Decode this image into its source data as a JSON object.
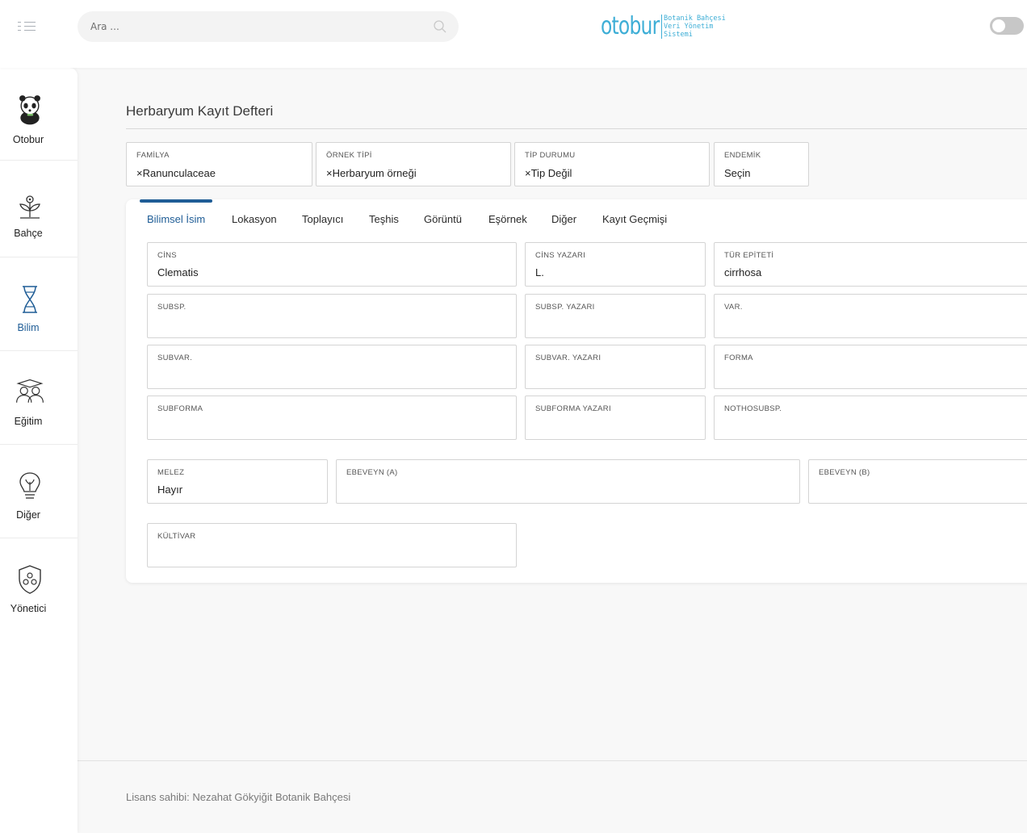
{
  "header": {
    "search_placeholder": "Ara ...",
    "logo_word": "otobur",
    "logo_sub": [
      "Botanik Bahçesi",
      "Veri Yönetim",
      "Sistemi"
    ]
  },
  "sidebar": {
    "items": [
      {
        "label": "Otobur",
        "icon": "panda-icon"
      },
      {
        "label": "Bahçe",
        "icon": "plant-icon"
      },
      {
        "label": "Bilim",
        "icon": "dna-icon"
      },
      {
        "label": "Eğitim",
        "icon": "graduation-icon"
      },
      {
        "label": "Diğer",
        "icon": "lightbulb-icon"
      },
      {
        "label": "Yönetici",
        "icon": "shield-icon"
      }
    ]
  },
  "page": {
    "title": "Herbaryum Kayıt Defteri"
  },
  "filters": [
    {
      "label": "FAMİLYA",
      "value": "×Ranunculaceae"
    },
    {
      "label": "ÖRNEK TİPİ",
      "value": "×Herbaryum örneği"
    },
    {
      "label": "TİP DURUMU",
      "value": "×Tip Değil"
    },
    {
      "label": "ENDEMİK",
      "value": "Seçin"
    }
  ],
  "tabs": [
    "Bilimsel İsim",
    "Lokasyon",
    "Toplayıcı",
    "Teşhis",
    "Görüntü",
    "Eşörnek",
    "Diğer",
    "Kayıt Geçmişi"
  ],
  "fields": {
    "cins": {
      "label": "CİNS",
      "value": "Clematis"
    },
    "cins_yazari": {
      "label": "CİNS YAZARI",
      "value": "L."
    },
    "tur_epiteti": {
      "label": "TÜR EPİTETİ",
      "value": "cirrhosa"
    },
    "subsp": {
      "label": "SUBSP.",
      "value": ""
    },
    "subsp_yazari": {
      "label": "SUBSP. YAZARI",
      "value": ""
    },
    "var": {
      "label": "VAR.",
      "value": ""
    },
    "subvar": {
      "label": "SUBVAR.",
      "value": ""
    },
    "subvar_yazari": {
      "label": "SUBVAR. YAZARI",
      "value": ""
    },
    "forma": {
      "label": "FORMA",
      "value": ""
    },
    "subforma": {
      "label": "SUBFORMA",
      "value": ""
    },
    "subforma_yazari": {
      "label": "SUBFORMA YAZARI",
      "value": ""
    },
    "nothosubsp": {
      "label": "NOTHOSUBSP.",
      "value": ""
    },
    "melez": {
      "label": "MELEZ",
      "value": "Hayır"
    },
    "ebeveyn_a": {
      "label": "EBEVEYN (A)",
      "value": ""
    },
    "ebeveyn_b": {
      "label": "EBEVEYN (B)",
      "value": ""
    },
    "kultivar": {
      "label": "KÜLTİVAR",
      "value": ""
    }
  },
  "footer": {
    "text": "Lisans sahibi: Nezahat Gökyiğit Botanik Bahçesi"
  },
  "colors": {
    "accent": "#1f5d96",
    "logo": "#3eaed6"
  }
}
